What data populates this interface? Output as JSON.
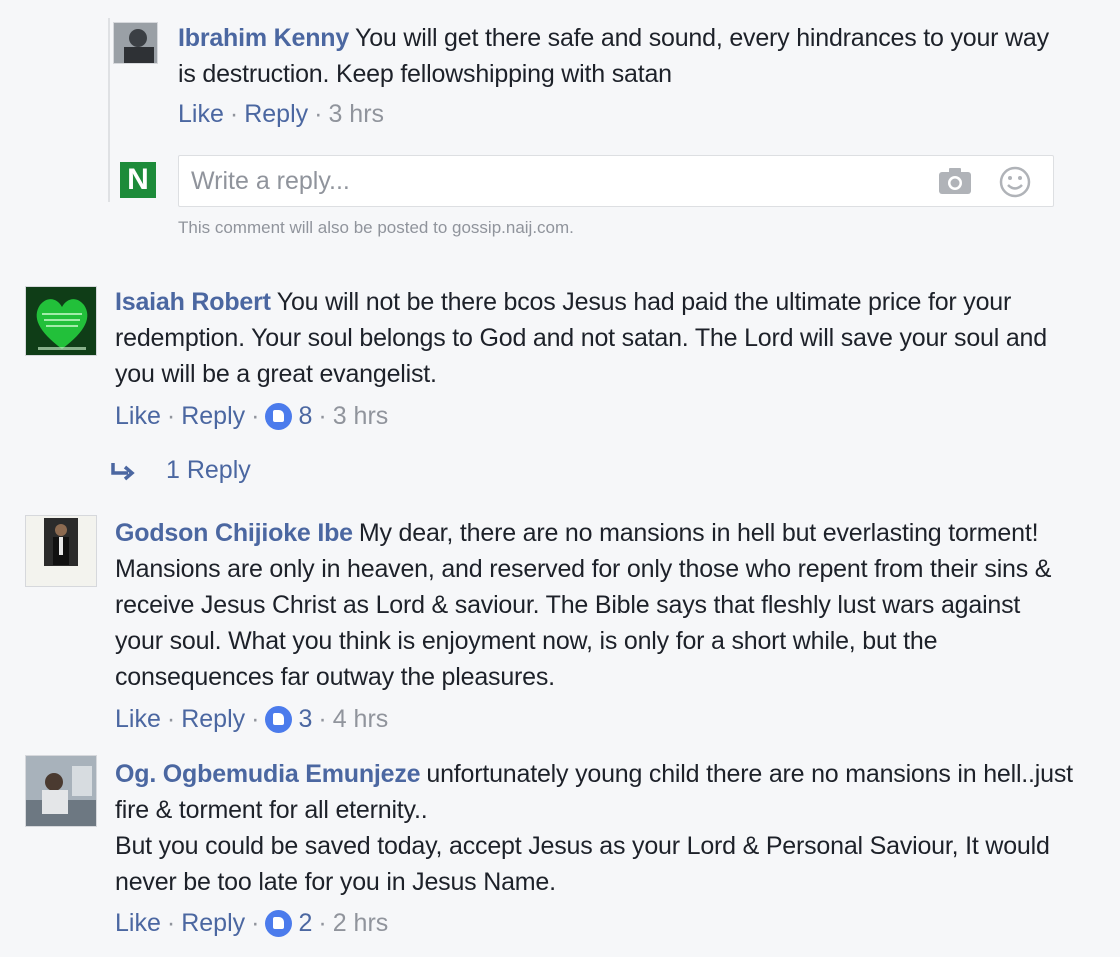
{
  "comments": [
    {
      "author": "Ibrahim Kenny",
      "text": "You will get there safe and sound, every hindrances to your way is destruction. Keep fellowshipping with satan",
      "actions": {
        "like": "Like",
        "reply": "Reply",
        "time": "3 hrs"
      }
    },
    {
      "author": "Isaiah Robert",
      "text": "You will not be there bcos Jesus had paid the ultimate price for your redemption. Your soul belongs to God and not satan. The Lord will save your soul and you will be a great evangelist.",
      "actions": {
        "like": "Like",
        "reply": "Reply",
        "likes": "8",
        "time": "3 hrs"
      }
    },
    {
      "author": "Godson Chijioke Ibe",
      "text": "My dear, there are no mansions in hell but everlasting torment! Mansions are only in heaven, and reserved for only those who repent from their sins & receive Jesus Christ as Lord & saviour. The Bible says that fleshly lust wars against your soul. What you think is enjoyment now, is only for a short while, but the consequences far outway the pleasures.",
      "actions": {
        "like": "Like",
        "reply": "Reply",
        "likes": "3",
        "time": "4 hrs"
      }
    },
    {
      "author": "Og. Ogbemudia Emunjeze",
      "text": "unfortunately young child there are no mansions in hell..just fire & torment for all eternity..",
      "text2": "But you could be saved today, accept Jesus as your Lord & Personal Saviour, It would never be too late for you in Jesus Name.",
      "actions": {
        "like": "Like",
        "reply": "Reply",
        "likes": "2",
        "time": "2 hrs"
      }
    }
  ],
  "reply_box": {
    "placeholder": "Write a reply...",
    "logo_letter": "N",
    "notice": "This comment will also be posted to gossip.naij.com."
  },
  "replies_link": "1 Reply",
  "colors": {
    "link": "#4b67a1",
    "muted": "#90949c",
    "like_badge": "#4b7bec",
    "logo": "#1d8b3a"
  },
  "icons": [
    "camera-icon",
    "emoji-icon",
    "reply-arrow-icon",
    "like-badge-icon"
  ]
}
